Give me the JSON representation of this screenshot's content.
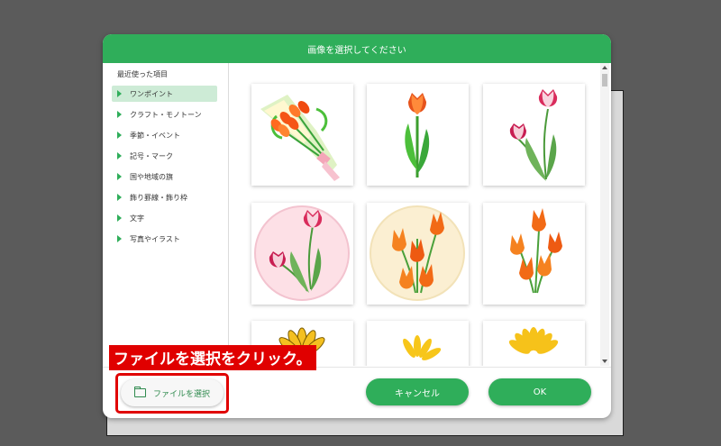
{
  "dialog": {
    "title": "画像を選択してください"
  },
  "sidebar": {
    "heading": "最近使った項目",
    "items": [
      {
        "label": "ワンポイント",
        "active": true
      },
      {
        "label": "クラフト・モノトーン"
      },
      {
        "label": "季節・イベント"
      },
      {
        "label": "記号・マーク"
      },
      {
        "label": "国や地域の旗"
      },
      {
        "label": "飾り罫線・飾り枠"
      },
      {
        "label": "文字"
      },
      {
        "label": "写真やイラスト"
      }
    ]
  },
  "gallery": {
    "items": [
      {
        "name": "tulip-bouquet"
      },
      {
        "name": "single-tulip"
      },
      {
        "name": "pink-tulips"
      },
      {
        "name": "pink-tulips-circle"
      },
      {
        "name": "orange-tulips-circle"
      },
      {
        "name": "orange-tulips"
      },
      {
        "name": "sunflower-partial"
      },
      {
        "name": "sunflower-partial"
      },
      {
        "name": "sunflower-partial"
      }
    ]
  },
  "footer": {
    "file_button": "ファイルを選択",
    "cancel_button": "キャンセル",
    "ok_button": "OK"
  },
  "annotation": {
    "callout": "ファイルを選択をクリック。"
  },
  "colors": {
    "accent": "#2fae5a",
    "highlight": "#e00000"
  },
  "icons": {
    "folder": "folder-icon",
    "expand": "triangle-right-icon"
  }
}
